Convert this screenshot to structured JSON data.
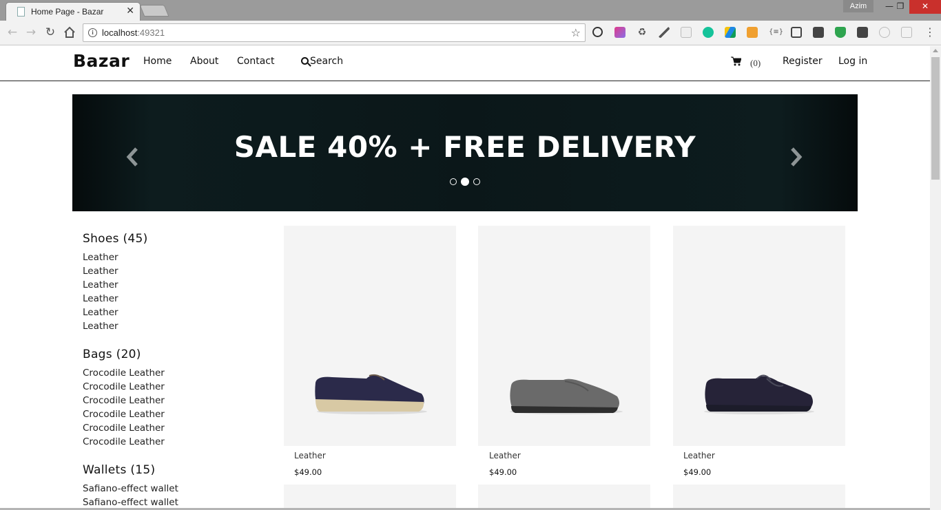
{
  "browser": {
    "tab_title": "Home Page - Bazar",
    "tab_close": "✕",
    "user": "Azim",
    "url_host": "localhost",
    "url_port": ":49321",
    "window_controls": [
      "—",
      "❐",
      "✕"
    ]
  },
  "site": {
    "logo": "Bazar",
    "nav": [
      "Home",
      "About",
      "Contact"
    ],
    "search_label": "Search",
    "cart_count": "(0)",
    "register": "Register",
    "login": "Log in"
  },
  "carousel": {
    "headline": "SALE 40% + FREE DELIVERY",
    "slide_count": 3,
    "active_slide": 2
  },
  "categories": [
    {
      "heading": "Shoes (45)",
      "items": [
        "Leather",
        "Leather",
        "Leather",
        "Leather",
        "Leather",
        "Leather"
      ]
    },
    {
      "heading": "Bags (20)",
      "items": [
        "Crocodile Leather",
        "Crocodile Leather",
        "Crocodile Leather",
        "Crocodile Leather",
        "Crocodile Leather",
        "Crocodile Leather"
      ]
    },
    {
      "heading": "Wallets (15)",
      "items": [
        "Safiano-effect wallet",
        "Safiano-effect wallet",
        "Safiano-effect wallet"
      ]
    }
  ],
  "products": [
    {
      "name": "Leather",
      "price": "$49.00",
      "style": "boat-navy"
    },
    {
      "name": "Leather",
      "price": "$49.00",
      "style": "loafer-grey"
    },
    {
      "name": "Leather",
      "price": "$49.00",
      "style": "driver-navy"
    }
  ],
  "colors": {
    "banner_bg": "#0b1719",
    "text": "#111111",
    "product_bg": "#f4f4f4"
  }
}
